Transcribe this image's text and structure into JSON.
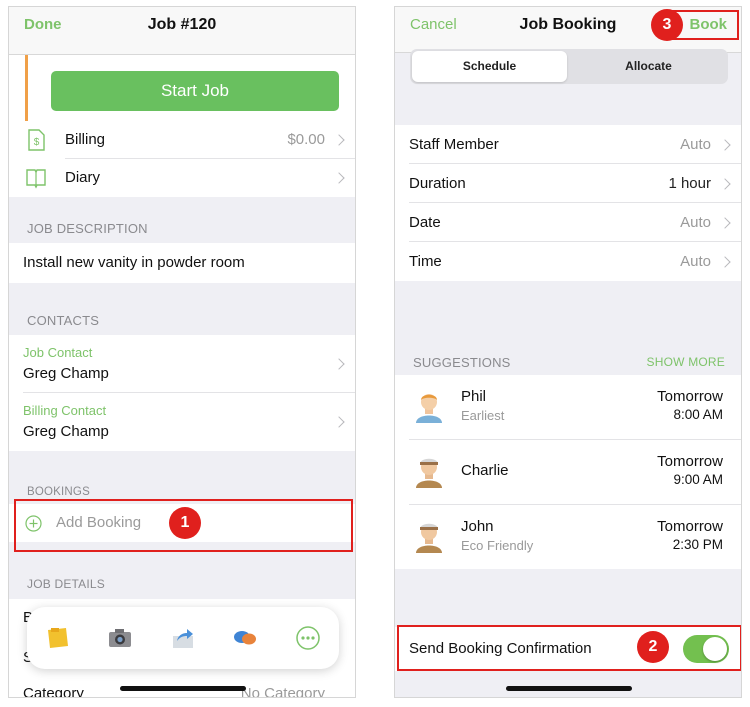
{
  "left": {
    "nav": {
      "done": "Done",
      "title": "Job #120"
    },
    "start_job": "Start Job",
    "billing": {
      "label": "Billing",
      "value": "$0.00"
    },
    "diary": {
      "label": "Diary"
    },
    "job_description": {
      "header": "JOB DESCRIPTION",
      "text": "Install new vanity in powder room"
    },
    "contacts": {
      "header": "CONTACTS",
      "items": [
        {
          "type": "Job Contact",
          "name": "Greg Champ"
        },
        {
          "type": "Billing Contact",
          "name": "Greg Champ"
        }
      ]
    },
    "bookings": {
      "header": "BOOKINGS",
      "add": "Add Booking"
    },
    "job_details": {
      "header": "JOB DETAILS",
      "partial_row1": "B",
      "partial_row2": "S",
      "category_label": "Category",
      "category_value": "No Category"
    },
    "toolbar_icons": [
      "sticky-note",
      "camera",
      "share",
      "chat",
      "more"
    ]
  },
  "right": {
    "nav": {
      "cancel": "Cancel",
      "title": "Job Booking",
      "book": "Book"
    },
    "segments": {
      "selected": "Schedule",
      "other": "Allocate"
    },
    "fields": [
      {
        "label": "Staff Member",
        "value": "Auto"
      },
      {
        "label": "Duration",
        "value": "1 hour"
      },
      {
        "label": "Date",
        "value": "Auto"
      },
      {
        "label": "Time",
        "value": "Auto"
      }
    ],
    "suggestions": {
      "header": "SUGGESTIONS",
      "show_more": "SHOW MORE",
      "items": [
        {
          "name": "Phil",
          "sub": "Earliest",
          "day": "Tomorrow",
          "time": "8:00 AM"
        },
        {
          "name": "Charlie",
          "sub": "",
          "day": "Tomorrow",
          "time": "9:00 AM"
        },
        {
          "name": "John",
          "sub": "Eco Friendly",
          "day": "Tomorrow",
          "time": "2:30 PM"
        }
      ]
    },
    "confirmation": {
      "label": "Send Booking Confirmation",
      "enabled": true
    }
  },
  "annotations": {
    "step1": "1",
    "step2": "2",
    "step3": "3"
  },
  "colors": {
    "accent_green": "#7ec36a",
    "start_button": "#69c05f",
    "highlight_red": "#e0201d",
    "toggle_on": "#73c04f",
    "orange_bar": "#f0a048"
  }
}
